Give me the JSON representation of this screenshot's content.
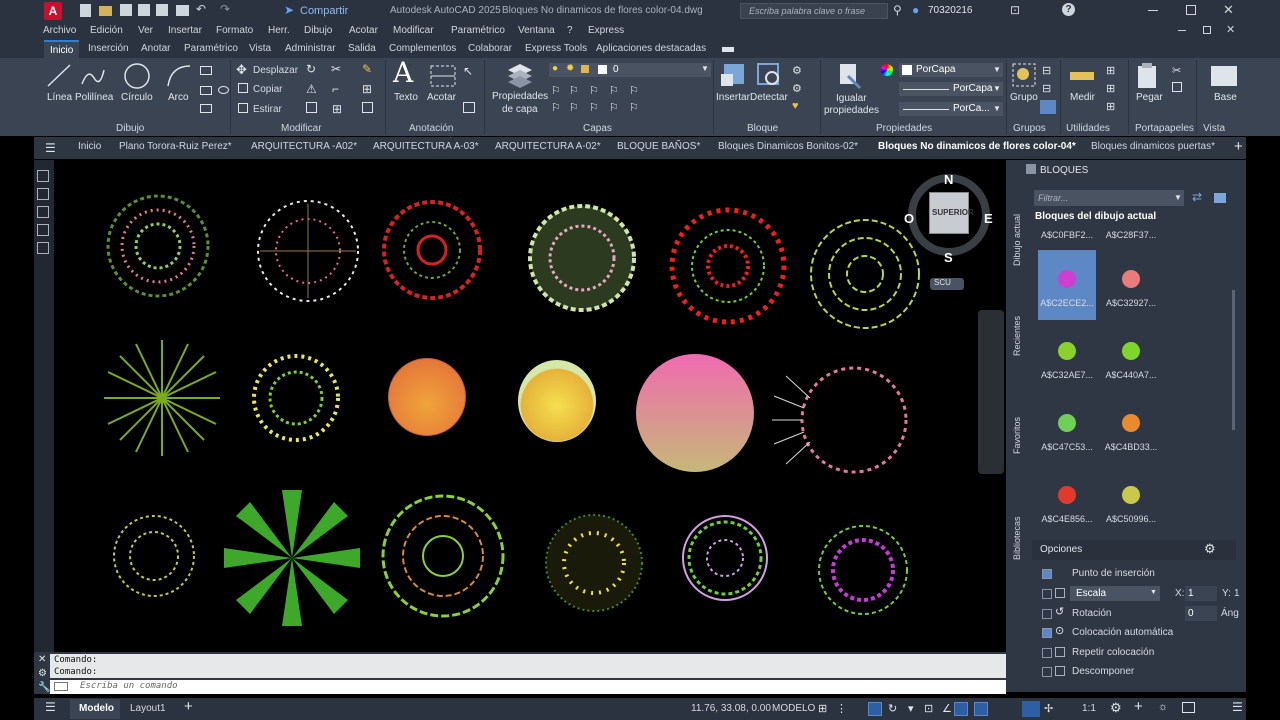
{
  "app": {
    "title": "Autodesk AutoCAD 2025",
    "document": "Bloques No dinamicos de flores color-04.dwg",
    "share_label": "Compartir",
    "search_placeholder": "Escriba palabra clave o frase",
    "user": "70320216"
  },
  "menubar": [
    "Archivo",
    "Edición",
    "Ver",
    "Insertar",
    "Formato",
    "Herr.",
    "Dibujo",
    "Acotar",
    "Modificar",
    "Paramétrico",
    "Ventana",
    "?",
    "Express"
  ],
  "ribbon_tabs": [
    "Inicio",
    "Inserción",
    "Anotar",
    "Paramétrico",
    "Vista",
    "Administrar",
    "Salida",
    "Complementos",
    "Colaborar",
    "Express Tools",
    "Aplicaciones destacadas"
  ],
  "ribbon": {
    "draw": {
      "line": "Línea",
      "polyline": "Polilínea",
      "circle": "Círculo",
      "arc": "Arco",
      "panel": "Dibujo"
    },
    "modify": {
      "move": "Desplazar",
      "copy": "Copiar",
      "stretch": "Estirar",
      "panel": "Modificar"
    },
    "annotation": {
      "text": "Texto",
      "dimension": "Acotar",
      "panel": "Anotación"
    },
    "layers": {
      "properties_1": "Propiedades",
      "properties_2": "de capa",
      "current_layer": "0",
      "panel": "Capas"
    },
    "block": {
      "insert": "Insertar",
      "edit": "Detectar",
      "panel": "Bloque"
    },
    "properties": {
      "match_1": "Igualar",
      "match_2": "propiedades",
      "color": "PorCapa",
      "linetype": "PorCapa",
      "lineweight": "PorCa...",
      "panel": "Propiedades"
    },
    "groups": {
      "group": "Grupo",
      "panel": "Grupos"
    },
    "utilities": {
      "measure": "Medir",
      "panel": "Utilidades"
    },
    "clipboard": {
      "paste": "Pegar",
      "panel": "Portapapeles"
    },
    "view": {
      "base": "Base",
      "panel": "Vista"
    }
  },
  "file_tabs": [
    "Inicio",
    "Plano Torora-Ruiz Perez*",
    "ARQUITECTURA -A02*",
    "ARQUITECTURA A-03*",
    "ARQUITECTURA A-02*",
    "BLOQUE BAÑOS*",
    "Bloques Dinamicos Bonitos-02*",
    "Bloques No dinamicos de flores color-04*",
    "Bloques dinamicos puertas*"
  ],
  "active_file_tab": "Bloques No dinamicos de flores color-04*",
  "viewcube": {
    "north": "N",
    "south": "S",
    "east": "E",
    "west": "O",
    "face": "SUPERIOR",
    "ucs": "SCU"
  },
  "palette": {
    "title": "BLOQUES",
    "filter_placeholder": "Filtrar...",
    "section": "Bloques del dibujo actual",
    "side_tabs": [
      "Dibujo actual",
      "Recientes",
      "Favoritos",
      "Bibliotecas"
    ],
    "items": [
      {
        "name": "A$C0FBF2...",
        "color": "#c43a3a"
      },
      {
        "name": "A$C28F37...",
        "color": "#c0c0c0"
      },
      {
        "name": "A$C2ECE2...",
        "color": "#cc3fd0"
      },
      {
        "name": "A$C32927...",
        "color": "#e97b7b"
      },
      {
        "name": "A$C32AE7...",
        "color": "#8ad12c"
      },
      {
        "name": "A$C440A7...",
        "color": "#7fd62a"
      },
      {
        "name": "A$C47C53...",
        "color": "#6fcf56"
      },
      {
        "name": "A$C4BD33...",
        "color": "#e88a2d"
      },
      {
        "name": "A$C4E856...",
        "color": "#e23a2a"
      },
      {
        "name": "A$C50996...",
        "color": "#c8c84a"
      }
    ],
    "options_title": "Opciones",
    "options": {
      "insertion_point": "Punto de inserción",
      "scale": "Escala",
      "scale_x_label": "X:",
      "scale_x": "1",
      "scale_y_label": "Y:",
      "scale_y": "1",
      "rotation": "Rotación",
      "rotation_value": "0",
      "angle_label": "Áng",
      "auto_place": "Colocación automática",
      "repeat": "Repetir colocación",
      "explode": "Descomponer"
    }
  },
  "command": {
    "history": [
      "Comando:",
      "Comando:"
    ],
    "placeholder": "Escriba un comando"
  },
  "status": {
    "model_tab": "Modelo",
    "layout_tab": "Layout1",
    "coords": "11.76, 33.08, 0.00",
    "mode": "MODELO",
    "scale": "1:1"
  }
}
